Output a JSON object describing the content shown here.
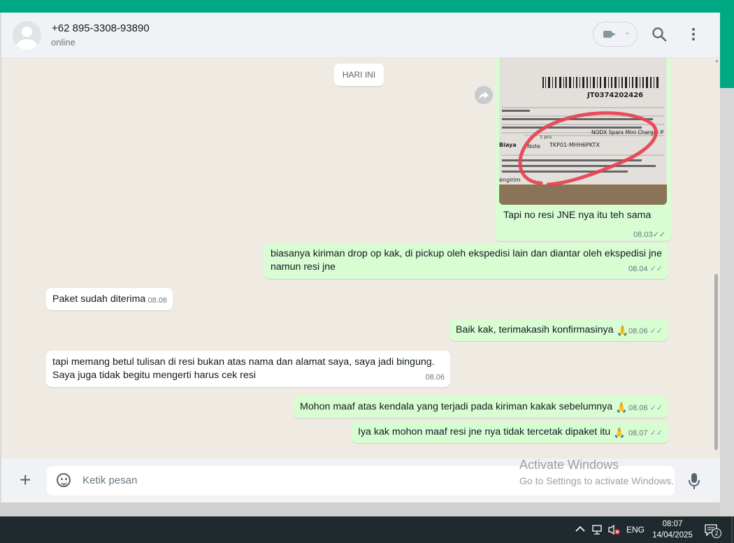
{
  "header": {
    "contact_name": "+62 895-3308-93890",
    "status": "online"
  },
  "chat": {
    "date_label": "HARI INI",
    "messages": [
      {
        "direction": "out",
        "type": "image",
        "caption": "Tapi no resi JNE nya itu teh sama",
        "time": "08.03",
        "image_text": [
          "JT0374202426",
          "NODX Sparx Mini Charger P",
          "TKP01-MHH6PKTX",
          "1 pcs",
          "Biaya",
          "Note",
          "engirim"
        ]
      },
      {
        "direction": "out",
        "text_line1": "biasanya kiriman drop op kak, di pickup oleh ekspedisi lain dan diantar oleh ekspedisi jne",
        "text_line2": "namun resi jne",
        "time": "08.04"
      },
      {
        "direction": "in",
        "text": "Paket sudah diterima",
        "time": "08.06"
      },
      {
        "direction": "out",
        "text": "Baik kak, terimakasih konfirmasinya",
        "emoji": "🙏",
        "time": "08.06"
      },
      {
        "direction": "in",
        "text_line1": "tapi memang betul tulisan di resi bukan atas nama dan alamat saya, saya jadi bingung.",
        "text_line2": "Saya juga tidak begitu mengerti harus cek resi",
        "time": "08.06"
      },
      {
        "direction": "out",
        "text": "Mohon maaf atas kendala yang terjadi pada kiriman kakak sebelumnya",
        "emoji": "🙏",
        "time": "08.06"
      },
      {
        "direction": "out",
        "text": "Iya kak mohon maaf resi jne nya tidak tercetak dipaket itu",
        "emoji": "🙏",
        "time": "08.07"
      }
    ]
  },
  "composer": {
    "placeholder": "Ketik pesan"
  },
  "watermark": {
    "line1": "Activate Windows",
    "line2": "Go to Settings to activate Windows."
  },
  "taskbar": {
    "language": "ENG",
    "time": "08:07",
    "date": "14/04/2025",
    "notification_count": "2"
  },
  "colors": {
    "accent": "#00a884",
    "outgoing_bubble": "#d9fdd3",
    "incoming_bubble": "#ffffff",
    "chat_bg": "#efeae2",
    "taskbar": "#1f2a2e"
  }
}
